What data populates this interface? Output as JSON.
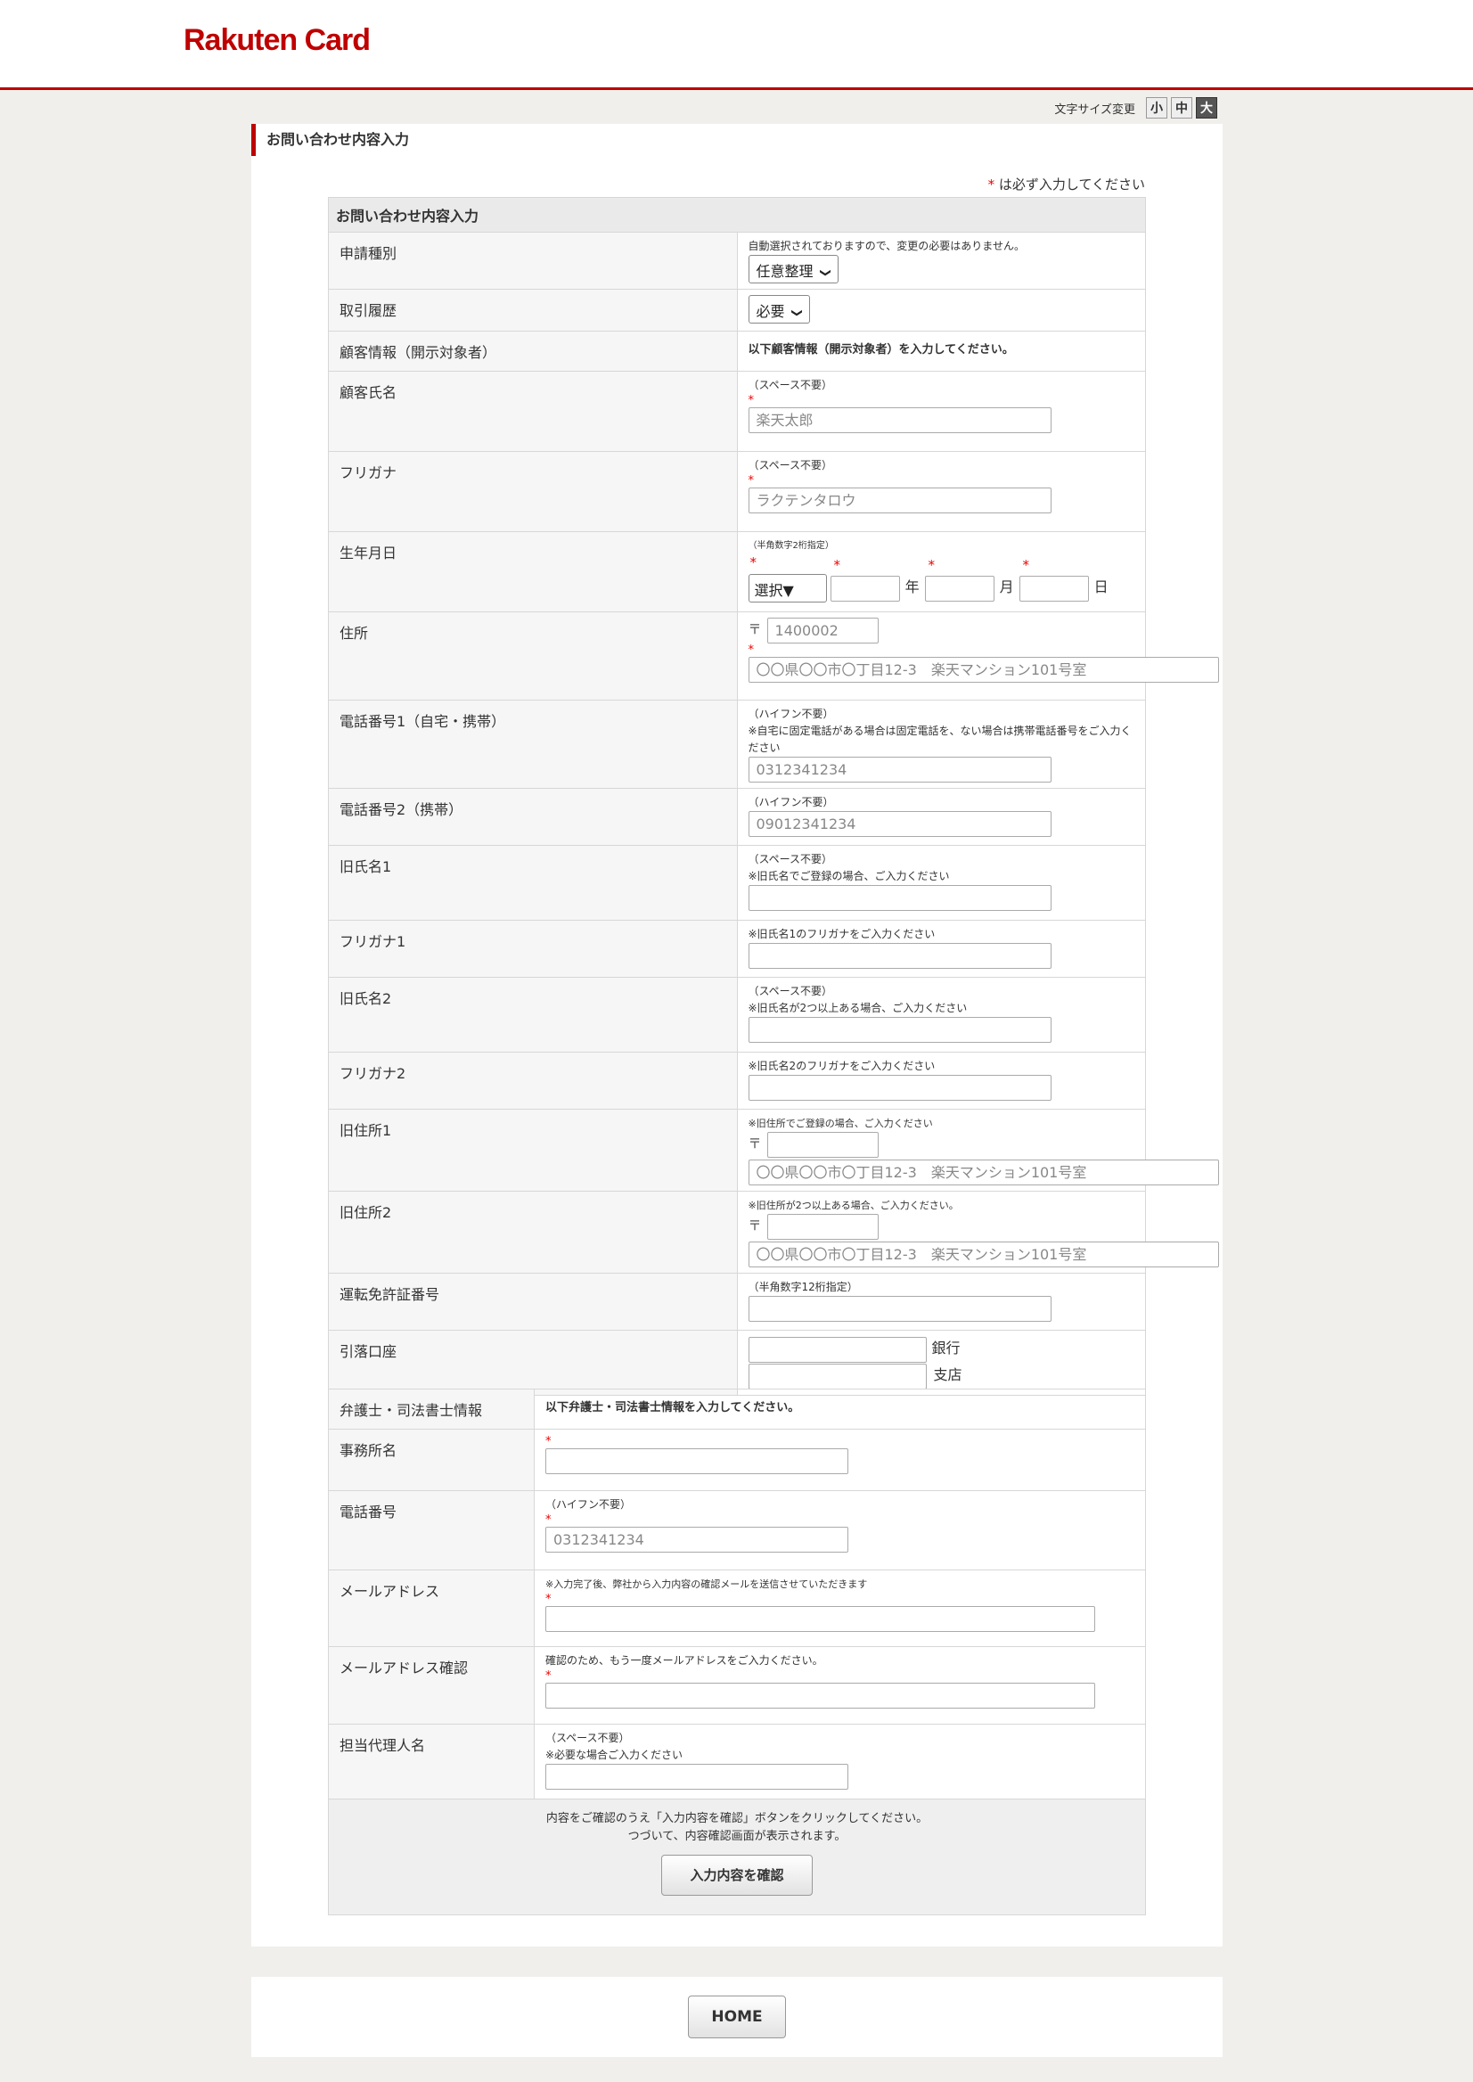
{
  "header": {
    "logo": "Rakuten Card"
  },
  "font_size": {
    "label": "文字サイズ変更",
    "small": "小",
    "medium": "中",
    "large": "大"
  },
  "page": {
    "title": "お問い合わせ内容入力",
    "required_note": "は必ず入力してください",
    "required_mark": "*"
  },
  "section1": {
    "header": "お問い合わせ内容入力",
    "application_type": {
      "label": "申請種別",
      "note": "自動選択されておりますので、変更の必要はありません。",
      "value": "任意整理"
    },
    "history": {
      "label": "取引履歴",
      "value": "必要"
    },
    "customer_info": {
      "label": "顧客情報（開示対象者）",
      "text": "以下顧客情報（開示対象者）を入力してください。"
    },
    "name": {
      "label": "顧客氏名",
      "note": "（スペース不要）",
      "placeholder": "楽天太郎"
    },
    "furigana": {
      "label": "フリガナ",
      "note": "（スペース不要）",
      "placeholder": "ラクテンタロウ"
    },
    "birthdate": {
      "label": "生年月日",
      "note": "（半角数字2桁指定）",
      "era": "選択▼",
      "year": "年",
      "month": "月",
      "day": "日"
    },
    "address": {
      "label": "住所",
      "zip_mark": "〒",
      "zip_placeholder": "1400002",
      "placeholder": "〇〇県〇〇市〇丁目12-3　楽天マンション101号室"
    },
    "phone1": {
      "label": "電話番号1（自宅・携帯）",
      "note1": "（ハイフン不要）",
      "note2": "※自宅に固定電話がある場合は固定電話を、ない場合は携帯電話番号をご入力ください",
      "placeholder": "0312341234"
    },
    "phone2": {
      "label": "電話番号2（携帯）",
      "note": "（ハイフン不要）",
      "placeholder": "09012341234"
    },
    "old_name1": {
      "label": "旧氏名1",
      "note1": "（スペース不要）",
      "note2": "※旧氏名でご登録の場合、ご入力ください"
    },
    "old_furigana1": {
      "label": "フリガナ1",
      "note": "※旧氏名1のフリガナをご入力ください"
    },
    "old_name2": {
      "label": "旧氏名2",
      "note1": "（スペース不要）",
      "note2": "※旧氏名が2つ以上ある場合、ご入力ください"
    },
    "old_furigana2": {
      "label": "フリガナ2",
      "note": "※旧氏名2のフリガナをご入力ください"
    },
    "old_address1": {
      "label": "旧住所1",
      "note": "※旧住所でご登録の場合、ご入力ください",
      "zip_mark": "〒",
      "placeholder": "〇〇県〇〇市〇丁目12-3　楽天マンション101号室"
    },
    "old_address2": {
      "label": "旧住所2",
      "note": "※旧住所が2つ以上ある場合、ご入力ください。",
      "zip_mark": "〒",
      "placeholder": "〇〇県〇〇市〇丁目12-3　楽天マンション101号室"
    },
    "license": {
      "label": "運転免許証番号",
      "note": "（半角数字12桁指定）"
    },
    "account": {
      "label": "引落口座",
      "bank": "銀行",
      "branch": "支店"
    }
  },
  "section2": {
    "lawyer_info": {
      "label": "弁護士・司法書士情報",
      "text": "以下弁護士・司法書士情報を入力してください。"
    },
    "office": {
      "label": "事務所名"
    },
    "phone": {
      "label": "電話番号",
      "note": "（ハイフン不要）",
      "placeholder": "0312341234"
    },
    "email": {
      "label": "メールアドレス",
      "note": "※入力完了後、弊社から入力内容の確認メールを送信させていただきます"
    },
    "email_confirm": {
      "label": "メールアドレス確認",
      "note": "確認のため、もう一度メールアドレスをご入力ください。"
    },
    "agent": {
      "label": "担当代理人名",
      "note1": "（スペース不要）",
      "note2": "※必要な場合ご入力ください"
    },
    "submit_note1": "内容をご確認のうえ「入力内容を確認」ボタンをクリックしてください。",
    "submit_note2": "つづいて、内容確認画面が表示されます。",
    "confirm_button": "入力内容を確認"
  },
  "footer": {
    "home_button": "HOME"
  },
  "colors": {
    "brand": "#bf0000",
    "required": "#ee0000",
    "background": "#f0efec"
  }
}
